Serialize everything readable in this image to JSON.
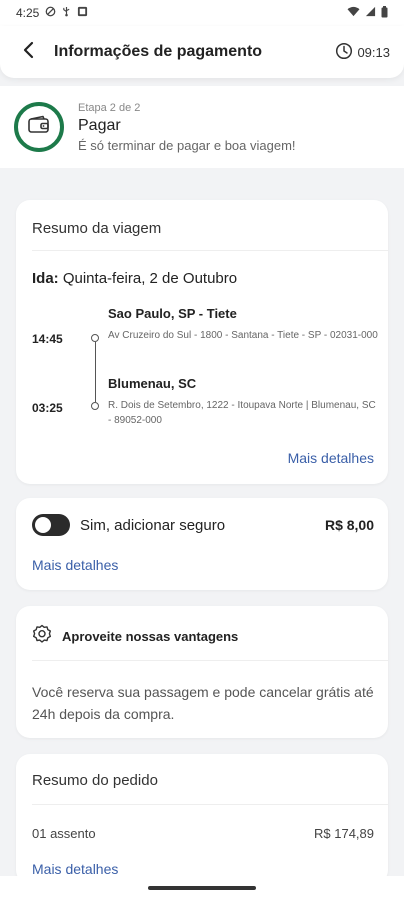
{
  "status_bar": {
    "time": "4:25"
  },
  "header": {
    "title": "Informações de pagamento",
    "timer": "09:13"
  },
  "step": {
    "label": "Etapa 2 de 2",
    "title": "Pagar",
    "subtitle": "É só terminar de pagar e boa viagem!"
  },
  "trip": {
    "card_title": "Resumo da viagem",
    "direction_label": "Ida:",
    "date": "Quinta-feira, 2 de Outubro",
    "stops": [
      {
        "time": "14:45",
        "city": "Sao Paulo, SP - Tiete",
        "address": "Av Cruzeiro do Sul - 1800 - Santana - Tiete - SP - 02031-000"
      },
      {
        "time": "03:25",
        "city": "Blumenau, SC",
        "address": "R. Dois de Setembro, 1222 - Itoupava Norte | Blumenau, SC - 89052-000"
      }
    ],
    "details_link": "Mais detalhes"
  },
  "insurance": {
    "label": "Sim, adicionar seguro",
    "price": "R$ 8,00",
    "enabled": false,
    "details_link": "Mais detalhes"
  },
  "advantages": {
    "title": "Aproveite nossas vantagens",
    "text": "Você reserva sua passagem e pode cancelar grátis até 24h depois da compra."
  },
  "order": {
    "card_title": "Resumo do pedido",
    "quantity": "01 assento",
    "price": "R$ 174,89",
    "details_link": "Mais detalhes"
  },
  "colors": {
    "accent_green": "#1d7a4a",
    "link_blue": "#3a5fa8",
    "background": "#f2f3f5"
  }
}
